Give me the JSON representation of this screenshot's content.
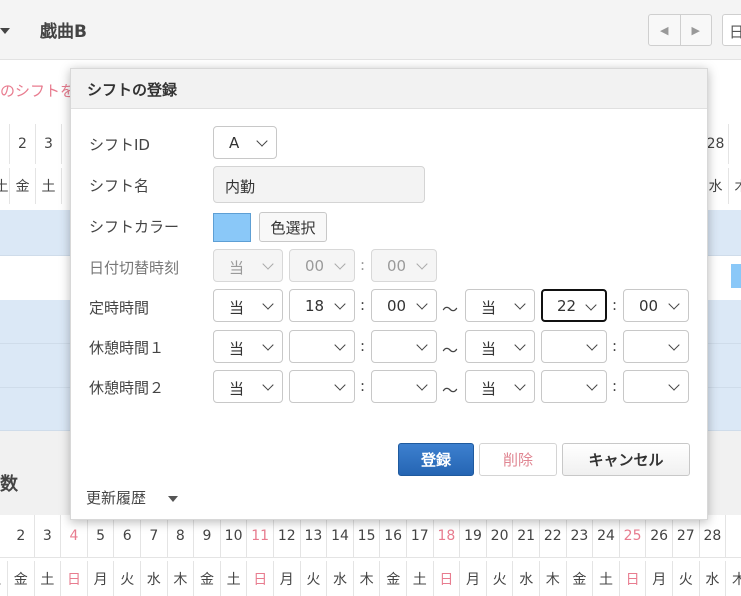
{
  "background": {
    "title": "戯曲B",
    "nav_prev": "◀",
    "nav_next": "▶",
    "day_button": "日",
    "red_text": "のシフトを",
    "top_dates": [
      "2",
      "3",
      "28"
    ],
    "top_weekdays": [
      "土",
      "金",
      "土",
      "水",
      "木"
    ],
    "kazu_label": "数",
    "bottom_dates": [
      "2",
      "3",
      "4",
      "5",
      "6",
      "7",
      "8",
      "9",
      "10",
      "11",
      "12",
      "13",
      "14",
      "15",
      "16",
      "17",
      "18",
      "19",
      "20",
      "21",
      "22",
      "23",
      "24",
      "25",
      "26",
      "27",
      "28"
    ],
    "bottom_weekdays": [
      "土",
      "金",
      "土",
      "日",
      "月",
      "火",
      "水",
      "木",
      "金",
      "土",
      "日",
      "月",
      "火",
      "水",
      "木",
      "金",
      "土",
      "日",
      "月",
      "火",
      "水",
      "木",
      "金",
      "土",
      "日",
      "月",
      "火",
      "水",
      "木"
    ],
    "sunday_color": "#e87c8f"
  },
  "dialog": {
    "title": "シフトの登録",
    "labels": {
      "shift_id": "シフトID",
      "shift_name": "シフト名",
      "shift_color": "シフトカラー",
      "date_switch": "日付切替時刻",
      "regular_time": "定時時間",
      "break1": "休憩時間１",
      "break2": "休憩時間２"
    },
    "shift_id_value": "A",
    "shift_name_value": "内勤",
    "color_button": "色選択",
    "swatch_color": "#8ac8f8",
    "date_switch": {
      "day": "当",
      "hour": "00",
      "minute": "00"
    },
    "regular": {
      "start_day": "当",
      "start_hour": "18",
      "start_minute": "00",
      "end_day": "当",
      "end_hour": "22",
      "end_minute": "00"
    },
    "break1": {
      "start_day": "当",
      "end_day": "当"
    },
    "break2": {
      "start_day": "当",
      "end_day": "当"
    },
    "colon": ":",
    "tilde": "〜",
    "buttons": {
      "register": "登録",
      "delete": "削除",
      "cancel": "キャンセル"
    },
    "history": "更新履歴"
  }
}
